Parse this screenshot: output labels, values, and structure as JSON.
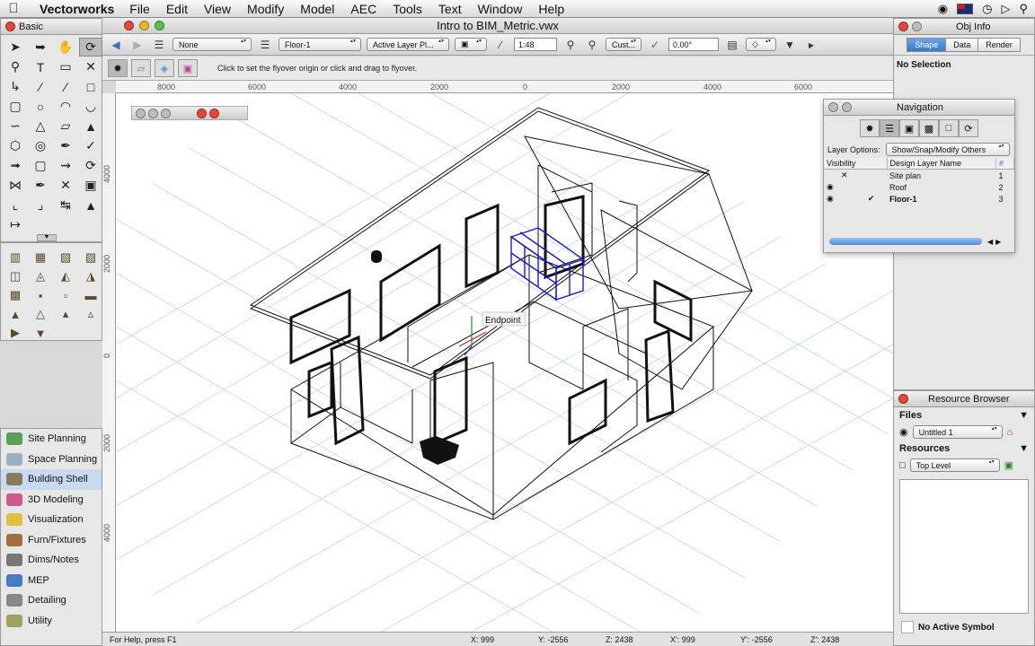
{
  "menubar": {
    "app": "Vectorworks",
    "items": [
      "File",
      "Edit",
      "View",
      "Modify",
      "Model",
      "AEC",
      "Tools",
      "Text",
      "Window",
      "Help"
    ]
  },
  "document": {
    "title": "Intro to BIM_Metric.vwx"
  },
  "palettes": {
    "basic_title": "Basic",
    "workspaces": [
      "Site Planning",
      "Space Planning",
      "Building Shell",
      "3D Modeling",
      "Visualization",
      "Furn/Fixtures",
      "Dims/Notes",
      "MEP",
      "Detailing",
      "Utility"
    ],
    "selected_workspace": "Building Shell"
  },
  "viewbar": {
    "class": "None",
    "layer": "Floor-1",
    "layer_mode": "Active Layer Pl...",
    "scale": "1:48",
    "view": "Cust...",
    "angle": "0.00°"
  },
  "modebar": {
    "message": "Click to set the flyover origin or click and drag to flyover."
  },
  "rulers": {
    "h_labels": [
      "8000",
      "6000",
      "4000",
      "2000",
      "0",
      "2000",
      "4000",
      "6000"
    ],
    "v_labels": [
      "4000",
      "2000",
      "0",
      "2000",
      "4000"
    ]
  },
  "canvas": {
    "snap_label": "Endpoint"
  },
  "status": {
    "help": "For Help, press F1",
    "x": "X: 999",
    "y": "Y: -2556",
    "z": "Z: 2438",
    "x2": "X': 999",
    "y2": "Y': -2556",
    "z2": "Z': 2438"
  },
  "objinfo": {
    "title": "Obj Info",
    "tabs": [
      "Shape",
      "Data",
      "Render"
    ],
    "active_tab": "Shape",
    "selection": "No Selection"
  },
  "navigation": {
    "title": "Navigation",
    "layer_options_label": "Layer Options:",
    "layer_options_value": "Show/Snap/Modify Others",
    "columns": [
      "Visibility",
      "Design Layer Name",
      "#"
    ],
    "layers": [
      {
        "name": "Site plan",
        "num": "1",
        "active": false
      },
      {
        "name": "Roof",
        "num": "2",
        "active": false
      },
      {
        "name": "Floor-1",
        "num": "3",
        "active": true
      }
    ]
  },
  "resources": {
    "title": "Resource Browser",
    "files_label": "Files",
    "file_value": "Untitled 1",
    "resources_label": "Resources",
    "resources_value": "Top Level",
    "symbol_status": "No Active Symbol"
  }
}
